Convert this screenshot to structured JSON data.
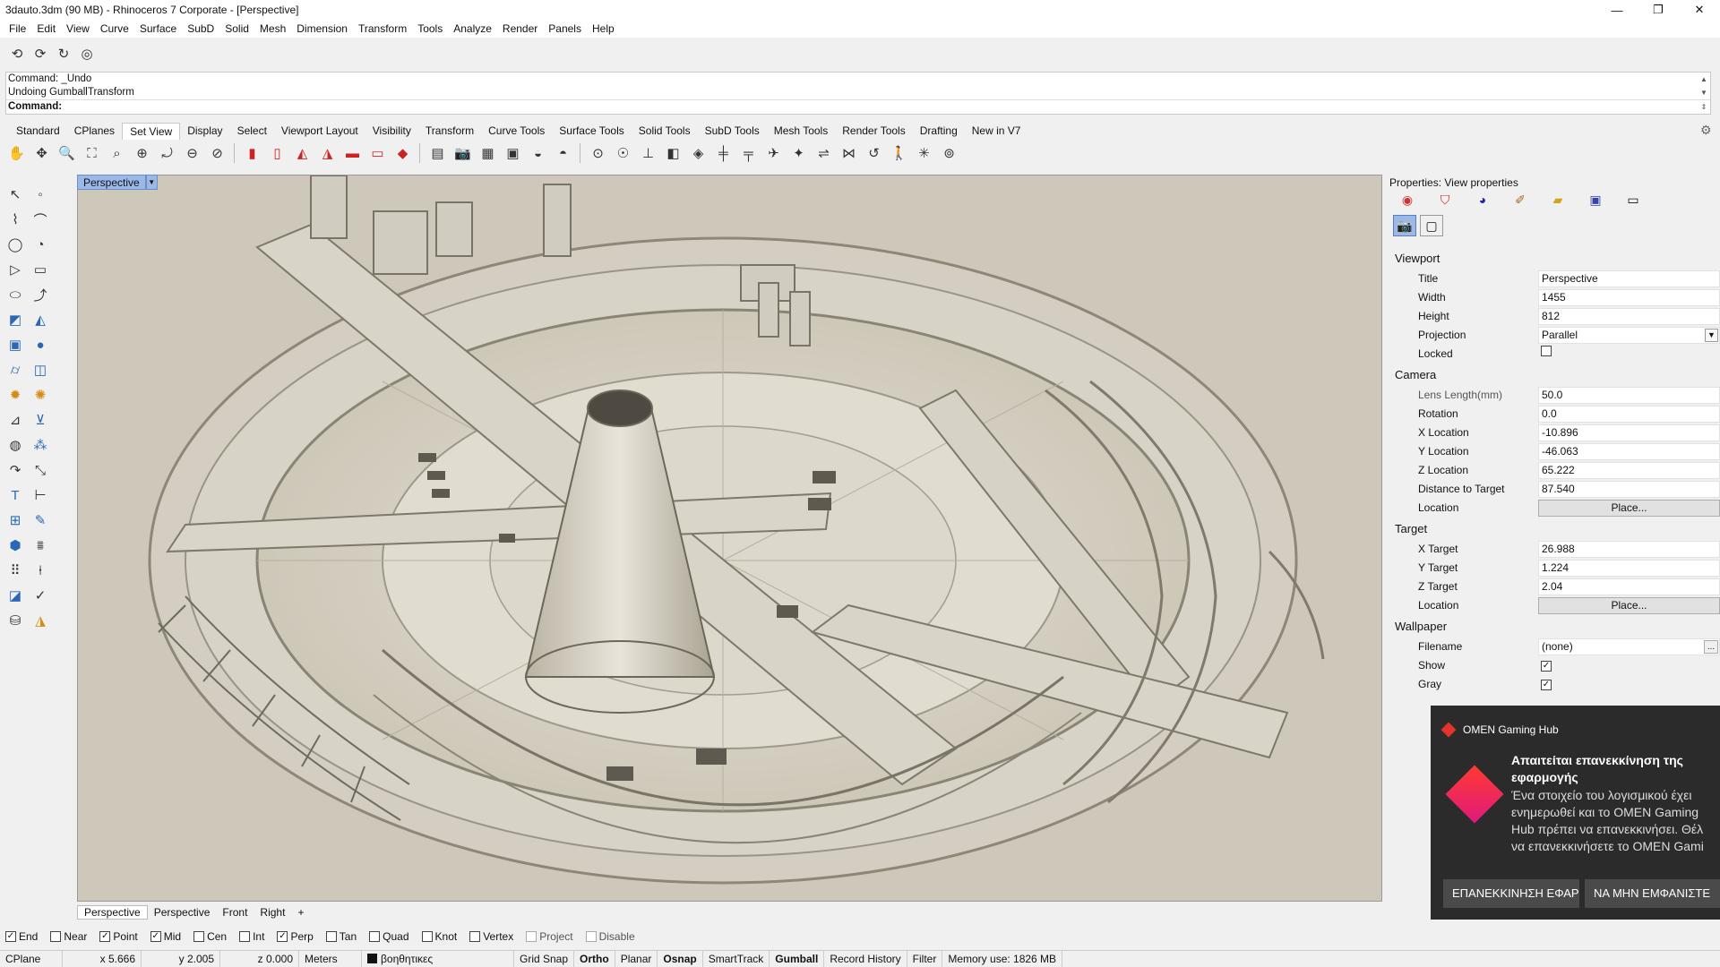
{
  "window": {
    "title": "3dauto.3dm (90 MB) - Rhinoceros 7 Corporate - [Perspective]",
    "minimize": "—",
    "maximize": "❐",
    "close": "✕"
  },
  "menu": [
    "File",
    "Edit",
    "View",
    "Curve",
    "Surface",
    "SubD",
    "Solid",
    "Mesh",
    "Dimension",
    "Transform",
    "Tools",
    "Analyze",
    "Render",
    "Panels",
    "Help"
  ],
  "command": {
    "history": [
      "Command: _Undo",
      "Undoing GumballTransform"
    ],
    "prompt": "Command:"
  },
  "toolbar_tabs": [
    "Standard",
    "CPlanes",
    "Set View",
    "Display",
    "Select",
    "Viewport Layout",
    "Visibility",
    "Transform",
    "Curve Tools",
    "Surface Tools",
    "Solid Tools",
    "SubD Tools",
    "Mesh Tools",
    "Render Tools",
    "Drafting",
    "New in V7"
  ],
  "active_tab": "Set View",
  "viewport": {
    "label": "Perspective",
    "tabs": [
      "Perspective",
      "Perspective",
      "Front",
      "Right"
    ],
    "add_tab": "+"
  },
  "osnap": [
    {
      "label": "End",
      "checked": true
    },
    {
      "label": "Near",
      "checked": false
    },
    {
      "label": "Point",
      "checked": true
    },
    {
      "label": "Mid",
      "checked": true
    },
    {
      "label": "Cen",
      "checked": false
    },
    {
      "label": "Int",
      "checked": false
    },
    {
      "label": "Perp",
      "checked": true
    },
    {
      "label": "Tan",
      "checked": false
    },
    {
      "label": "Quad",
      "checked": false
    },
    {
      "label": "Knot",
      "checked": false
    },
    {
      "label": "Vertex",
      "checked": false
    },
    {
      "label": "Project",
      "checked": false
    },
    {
      "label": "Disable",
      "checked": false
    }
  ],
  "status": {
    "cplane": "CPlane",
    "x": "x 5.666",
    "y": "y 2.005",
    "z": "z 0.000",
    "units": "Meters",
    "layer": "βοηθητικες",
    "grid_snap": "Grid Snap",
    "ortho": "Ortho",
    "planar": "Planar",
    "osnap": "Osnap",
    "smarttrack": "SmartTrack",
    "gumball": "Gumball",
    "record_history": "Record History",
    "filter": "Filter",
    "memory": "Memory use: 1826 MB"
  },
  "properties": {
    "title": "Properties: View properties",
    "sections": {
      "viewport": "Viewport",
      "camera": "Camera",
      "target": "Target",
      "wallpaper": "Wallpaper"
    },
    "viewport_rows": {
      "title_label": "Title",
      "title_value": "Perspective",
      "width_label": "Width",
      "width_value": "1455",
      "height_label": "Height",
      "height_value": "812",
      "projection_label": "Projection",
      "projection_value": "Parallel",
      "locked_label": "Locked",
      "locked_checked": false
    },
    "camera_rows": {
      "lens_label": "Lens Length(mm)",
      "lens_value": "50.0",
      "rotation_label": "Rotation",
      "rotation_value": "0.0",
      "xloc_label": "X Location",
      "xloc_value": "-10.896",
      "yloc_label": "Y Location",
      "yloc_value": "-46.063",
      "zloc_label": "Z Location",
      "zloc_value": "65.222",
      "dist_label": "Distance to Target",
      "dist_value": "87.540",
      "loc_label": "Location",
      "loc_button": "Place..."
    },
    "target_rows": {
      "xt_label": "X Target",
      "xt_value": "26.988",
      "yt_label": "Y Target",
      "yt_value": "1.224",
      "zt_label": "Z Target",
      "zt_value": "2.04",
      "loc_label": "Location",
      "loc_button": "Place..."
    },
    "wallpaper_rows": {
      "file_label": "Filename",
      "file_value": "(none)",
      "file_button": "...",
      "show_label": "Show",
      "show_checked": true,
      "gray_label": "Gray",
      "gray_checked": true
    }
  },
  "toast": {
    "app": "OMEN Gaming Hub",
    "heading": "Απαιτείται επανεκκίνηση της εφαρμογής",
    "body_lines": [
      "Ένα στοιχείο του λογισμικού έχει",
      "ενημερωθεί και το OMEN Gaming",
      "Hub πρέπει να επανεκκινήσει. Θέλ",
      "να επανεκκινήσετε το OMEN Gami"
    ],
    "restart_button": "ΕΠΑΝΕΚΚΙΝΗΣΗ ΕΦΑΡΜ",
    "dismiss_button": "ΝΑ ΜΗΝ ΕΜΦΑΝΙΣΤΕ"
  },
  "icons": {
    "top": [
      "undo-view-icon",
      "redo-view-icon",
      "rotate-icon",
      "refresh-icon"
    ],
    "toolbar": [
      "pan-icon",
      "rotate-view-icon",
      "zoom-icon",
      "zoom-extents-icon",
      "zoom-window-icon",
      "zoom-selected-icon",
      "zoom-target-icon",
      "zoom-1to1-icon",
      "top-view-icon",
      "bottom-view-icon",
      "left-view-icon",
      "right-view-icon",
      "front-view-icon",
      "back-view-icon",
      "perspective-view-icon",
      "camera-icon",
      "named-view-icon",
      "snapshot-icon",
      "record-icon",
      "print-preview-icon",
      "set-cplane-icon",
      "target-icon",
      "orient-icon",
      "axis-icon",
      "view-cube-icon",
      "plane-icon",
      "dolly-icon",
      "flat-icon",
      "fly-icon",
      "elevator-icon",
      "walkabout-icon",
      "sun-icon",
      "compass-icon"
    ],
    "left": [
      "select-icon",
      "point-icon",
      "polyline-icon",
      "curve-icon",
      "circle-icon",
      "arc-icon",
      "polygon-icon",
      "rectangle-icon",
      "ellipse-icon",
      "fillet-curve-icon",
      "surface-icon",
      "patch-icon",
      "box-icon",
      "sphere-icon",
      "cylinder-icon",
      "extrude-icon",
      "boolean-icon",
      "explode-icon",
      "move-icon",
      "split-icon",
      "group-icon",
      "layer-icon",
      "rotate-obj-icon",
      "scale-icon",
      "text-icon",
      "dimension-icon",
      "block-icon",
      "edit-icon",
      "cube-render-icon",
      "analyze-icon",
      "array-icon",
      "align-icon",
      "transform-icon",
      "check-icon",
      "light-icon",
      "paint-icon"
    ]
  },
  "colors": {
    "viewport_bg": "#cfcabc",
    "label_blue": "#9bb8e6",
    "toast_bg": "#2b2b2b",
    "omen_red": "#e5322d"
  }
}
